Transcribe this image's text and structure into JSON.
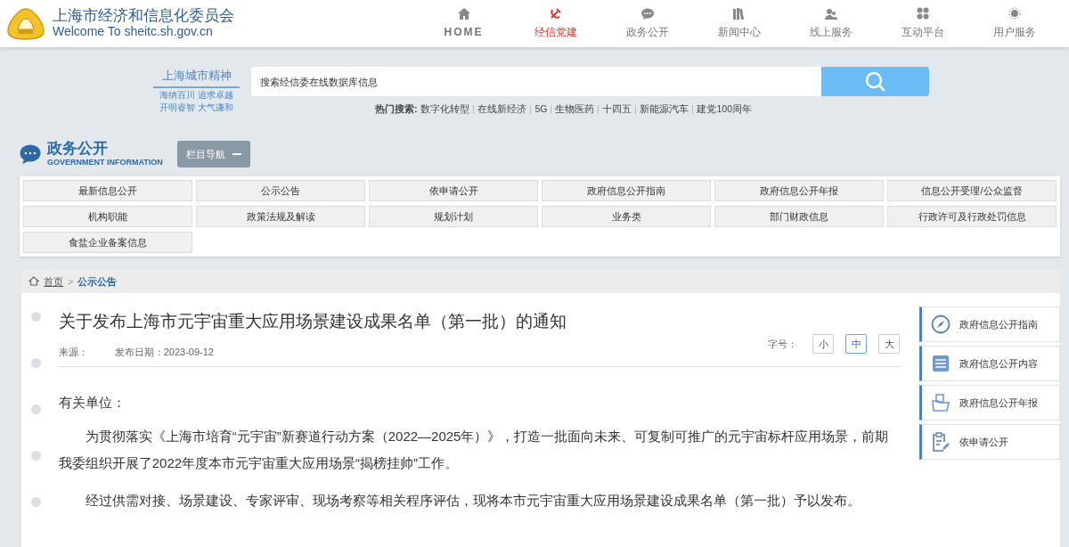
{
  "header": {
    "site_title": "上海市经济和信息化委员会",
    "site_subtitle": "Welcome To sheitc.sh.gov.cn"
  },
  "nav": [
    {
      "kind": "home",
      "label": "HOME",
      "selected": false
    },
    {
      "kind": "party",
      "label": "经信党建",
      "selected": true
    },
    {
      "kind": "chat",
      "label": "政务公开",
      "selected": false
    },
    {
      "kind": "news",
      "label": "新闻中心",
      "selected": false
    },
    {
      "kind": "users",
      "label": "线上服务",
      "selected": false
    },
    {
      "kind": "grid",
      "label": "互动平台",
      "selected": false
    },
    {
      "kind": "user",
      "label": "用户服务",
      "selected": false
    }
  ],
  "slogan": {
    "title": "上海城市精神",
    "lines": [
      "海纳百川 追求卓越",
      "开明睿智 大气谦和"
    ]
  },
  "search": {
    "placeholder": "搜索经信委在线数据库信息",
    "hot_label": "热门搜索:",
    "hot_terms": [
      "数字化转型",
      "在线新经济",
      "5G",
      "生物医药",
      "十四五",
      "新能源汽车",
      "建党100周年"
    ]
  },
  "section": {
    "title": "政务公开",
    "subtitle": "GOVERNMENT INFORMATION",
    "toggle": "栏目导航"
  },
  "categories": [
    "最新信息公开",
    "公示公告",
    "依申请公开",
    "政府信息公开指南",
    "政府信息公开年报",
    "信息公开受理/公众监督",
    "机构职能",
    "政策法规及解读",
    "规划计划",
    "业务类",
    "部门财政信息",
    "行政许可及行政处罚信息",
    "食盐企业备案信息"
  ],
  "breadcrumb_separator": ">",
  "breadcrumb": [
    {
      "label": "首页"
    },
    {
      "label": "公示公告"
    }
  ],
  "article": {
    "title": "关于发布上海市元宇宙重大应用场景建设成果名单（第一批）的通知",
    "source_label": "来源：",
    "date": "发布日期：2023-09-12",
    "font_size_label": "字号：",
    "font_sizes": [
      {
        "label": "小",
        "selected": false
      },
      {
        "label": "中",
        "selected": true
      },
      {
        "label": "大",
        "selected": false
      }
    ],
    "salutation": "有关单位：",
    "paragraphs": [
      "为贯彻落实《上海市培育“元宇宙”新赛道行动方案（2022—2025年）》，打造一批面向未来、可复制可推广的元宇宙标杆应用场景，前期我委组织开展了2022年度本市元宇宙重大应用场景“揭榜挂帅”工作。",
      "经过供需对接、场景建设、专家评审、现场考察等相关程序评估，现将本市元宇宙重大应用场景建设成果名单（第一批）予以发布。"
    ]
  },
  "sidebar": [
    {
      "kind": "compass",
      "label": "政府信息公开指南"
    },
    {
      "kind": "list",
      "label": "政府信息公开内容"
    },
    {
      "kind": "folder",
      "label": "政府信息公开年报"
    },
    {
      "kind": "clipboard",
      "label": "依申请公开"
    }
  ]
}
